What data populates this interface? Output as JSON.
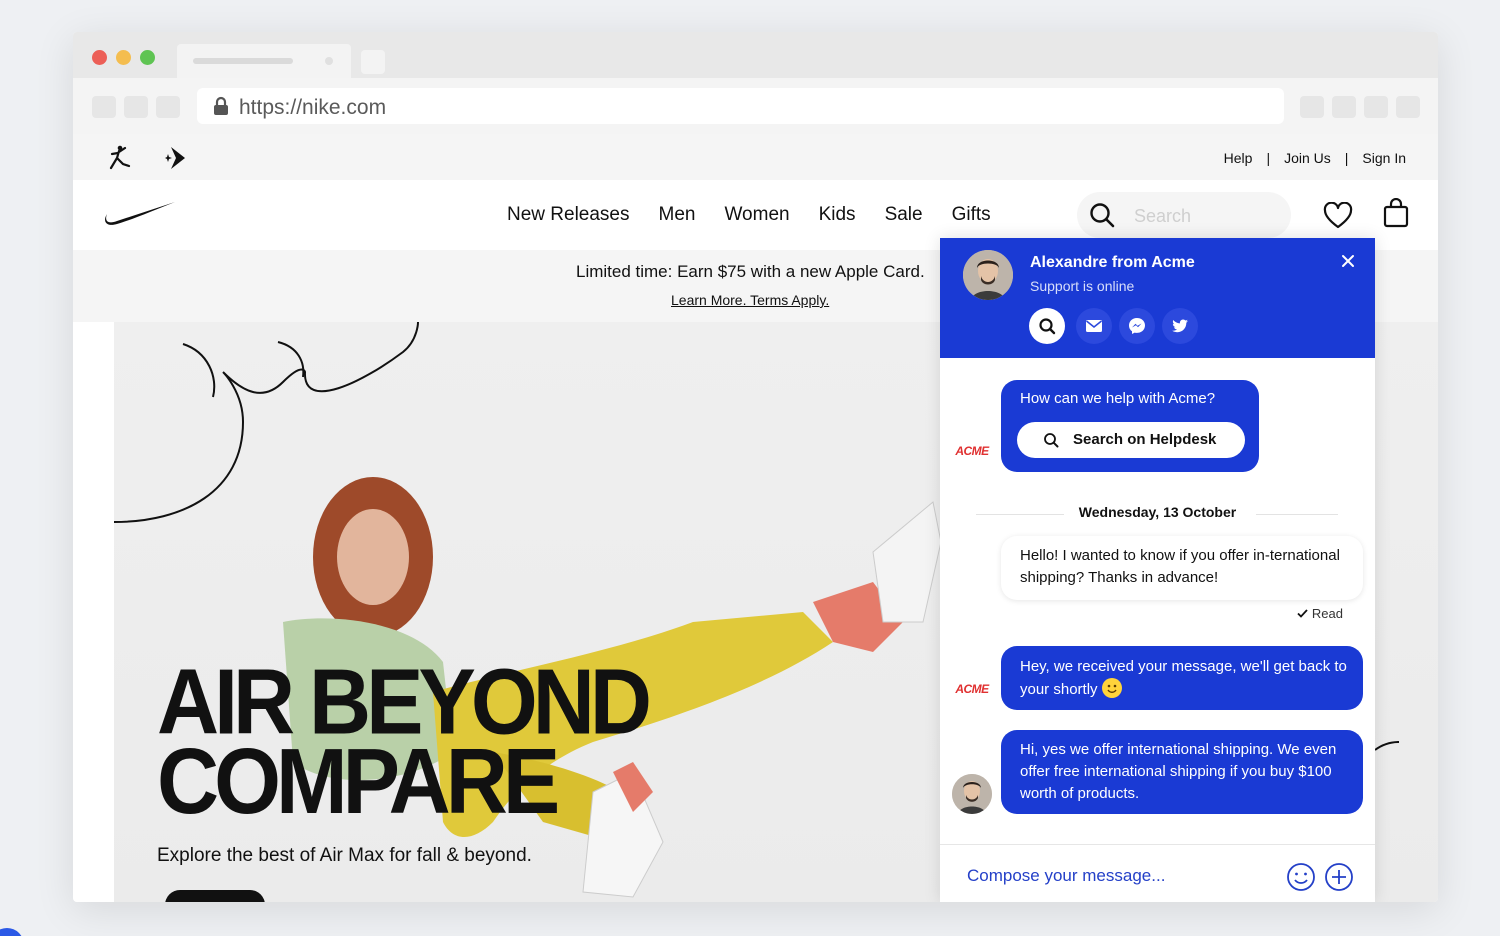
{
  "browser": {
    "url": "https://nike.com"
  },
  "utility_links": [
    "Help",
    "Join Us",
    "Sign In"
  ],
  "utility_separator": "|",
  "nav": {
    "items": [
      "New Releases",
      "Men",
      "Women",
      "Kids",
      "Sale",
      "Gifts"
    ],
    "search_placeholder": "Search"
  },
  "promo": {
    "text": "Limited time: Earn $75 with a new Apple Card.",
    "link": "Learn More. Terms Apply."
  },
  "hero": {
    "title_line1": "AIR BEYOND",
    "title_line2": "COMPARE",
    "subtitle": "Explore the best of Air Max for fall & beyond."
  },
  "chat": {
    "agent_name": "Alexandre from Acme",
    "agent_status": "Support is online",
    "brand_logo": "ACME",
    "social_icons": [
      "search-icon",
      "email-icon",
      "messenger-icon",
      "twitter-icon"
    ],
    "bot_prompt": "How can we help with Acme?",
    "helpdesk_button": "Search on Helpdesk",
    "date_divider": "Wednesday, 13 October",
    "user_message": "Hello! I wanted to know if you offer in-ternational shipping? Thanks in advance!",
    "read_status": "Read",
    "bot_reply": "Hey, we received your message, we'll get back to your shortly",
    "agent_reply": "Hi, yes we offer international shipping. We even offer free international shipping if you buy $100 worth of products.",
    "compose_placeholder": "Compose your message..."
  },
  "colors": {
    "chat_blue": "#1a3ad4",
    "acme_red": "#e03131"
  }
}
